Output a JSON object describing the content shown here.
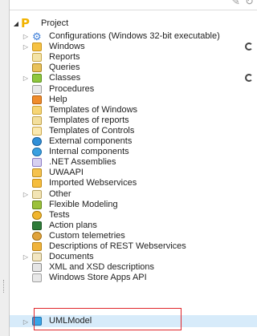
{
  "toolbar": {
    "icons": [
      "pencil-icon",
      "refresh-icon"
    ]
  },
  "tree": {
    "root": {
      "label": "Project",
      "icon": "project-icon",
      "expanded": true
    },
    "items": [
      {
        "label": "Configurations (Windows 32-bit executable)",
        "icon": "gear-icon",
        "expandable": true,
        "pending": false
      },
      {
        "label": "Windows",
        "icon": "windows-folder-icon",
        "expandable": true,
        "pending": true
      },
      {
        "label": "Reports",
        "icon": "report-icon",
        "expandable": false,
        "pending": false
      },
      {
        "label": "Queries",
        "icon": "query-icon",
        "expandable": false,
        "pending": false
      },
      {
        "label": "Classes",
        "icon": "class-icon",
        "expandable": true,
        "pending": true
      },
      {
        "label": "Procedures",
        "icon": "procedure-icon",
        "expandable": false,
        "pending": false
      },
      {
        "label": "Help",
        "icon": "help-icon",
        "expandable": false,
        "pending": false
      },
      {
        "label": "Templates of Windows",
        "icon": "window-template-icon",
        "expandable": false,
        "pending": false
      },
      {
        "label": "Templates of reports",
        "icon": "report-template-icon",
        "expandable": false,
        "pending": false
      },
      {
        "label": "Templates of Controls",
        "icon": "control-template-icon",
        "expandable": false,
        "pending": false
      },
      {
        "label": "External components",
        "icon": "external-component-icon",
        "expandable": false,
        "pending": false
      },
      {
        "label": "Internal components",
        "icon": "internal-component-icon",
        "expandable": false,
        "pending": false
      },
      {
        "label": ".NET Assemblies",
        "icon": "net-assembly-icon",
        "expandable": false,
        "pending": false
      },
      {
        "label": "UWAAPI",
        "icon": "uwaapi-icon",
        "expandable": false,
        "pending": false
      },
      {
        "label": "Imported Webservices",
        "icon": "webservice-icon",
        "expandable": false,
        "pending": false
      },
      {
        "label": "Other",
        "icon": "other-icon",
        "expandable": true,
        "pending": false
      },
      {
        "label": "Flexible Modeling",
        "icon": "flexible-modeling-icon",
        "expandable": false,
        "pending": false
      },
      {
        "label": "Tests",
        "icon": "tests-icon",
        "expandable": false,
        "pending": false
      },
      {
        "label": "Action plans",
        "icon": "action-plan-icon",
        "expandable": false,
        "pending": false
      },
      {
        "label": "Custom telemetries",
        "icon": "telemetry-icon",
        "expandable": false,
        "pending": false
      },
      {
        "label": "Descriptions of REST Webservices",
        "icon": "rest-webservice-icon",
        "expandable": false,
        "pending": false
      },
      {
        "label": "Documents",
        "icon": "documents-icon",
        "expandable": true,
        "pending": false
      },
      {
        "label": "XML and XSD descriptions",
        "icon": "xml-icon",
        "expandable": false,
        "pending": false
      },
      {
        "label": "Windows Store Apps API",
        "icon": "store-api-icon",
        "expandable": false,
        "pending": false
      },
      {
        "label": "UMLModel",
        "icon": "uml-model-icon",
        "expandable": true,
        "pending": false,
        "selected": true
      }
    ]
  },
  "colors": {
    "highlight": "#e0262b",
    "selection": "#d7ebfa"
  }
}
